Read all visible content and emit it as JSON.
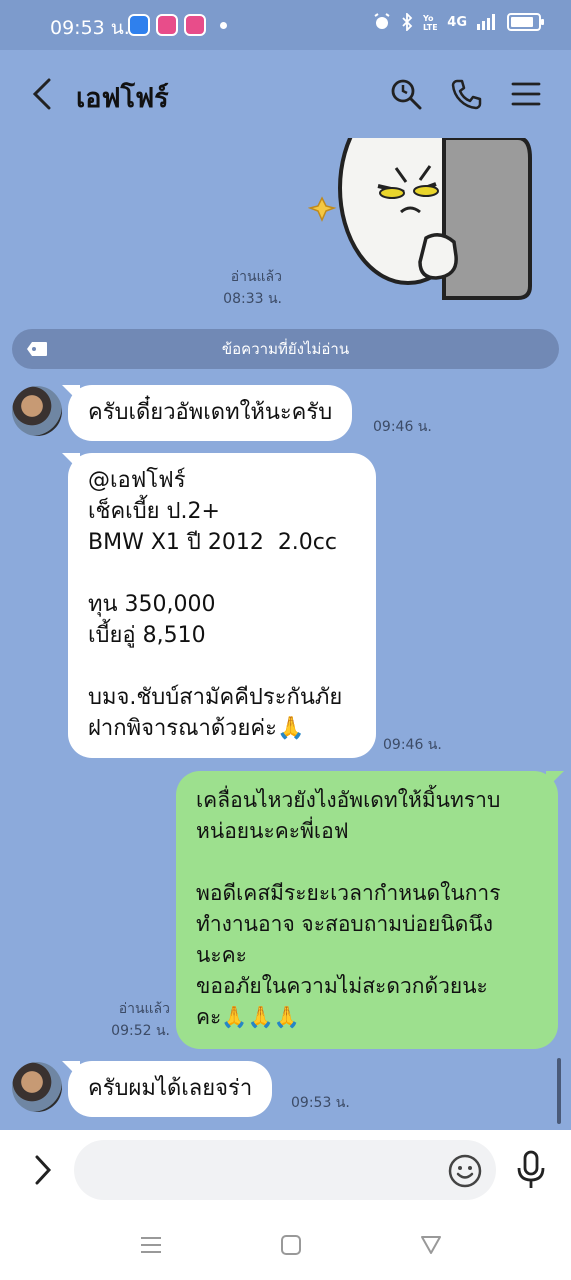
{
  "status_bar": {
    "time": "09:53 น.",
    "network": "4G"
  },
  "header": {
    "title": "เอฟโฟร์",
    "icons": [
      "back-icon",
      "search-icon",
      "phone-icon",
      "menu-icon"
    ]
  },
  "chat": {
    "sticker_read": {
      "label": "อ่านแล้ว",
      "time": "08:33 น."
    },
    "unread_divider": "ข้อความที่ยังไม่อ่าน",
    "messages": [
      {
        "side": "in",
        "text": "ครับเดี๋ยวอัพเดทให้นะครับ",
        "time": "09:46 น."
      },
      {
        "side": "in",
        "text": "@เอฟโฟร์\nเช็คเบี้ย ป.2+\nBMW X1 ปี 2012  2.0cc\n\nทุน 350,000\nเบี้ยอู่ 8,510\n\nบมจ.ชับบ์สามัคคีประกันภัย\nฝากพิจารณาด้วยค่ะ🙏",
        "time": "09:46 น."
      },
      {
        "side": "out",
        "text": "เคลื่อนไหวยังไงอัพเดทให้มิ้นทราบ\nหน่อยนะคะพี่เอฟ\n\nพอดีเคสมีระยะเวลากำหนดในการ\nทำงานอาจ จะสอบถามบ่อยนิดนึง\nนะคะ\nขออภัยในความไม่สะดวกด้วยนะ\nคะ🙏🙏🙏",
        "read": "อ่านแล้ว",
        "time": "09:52 น."
      },
      {
        "side": "in",
        "text": "ครับผมได้เลยจร่า",
        "time": "09:53 น."
      }
    ]
  },
  "input": {
    "placeholder": "",
    "value": ""
  },
  "colors": {
    "chat_bg": "#8caadb",
    "out_bubble": "#9de08e",
    "in_bubble": "#ffffff",
    "unread_bar": "#7189b5"
  }
}
